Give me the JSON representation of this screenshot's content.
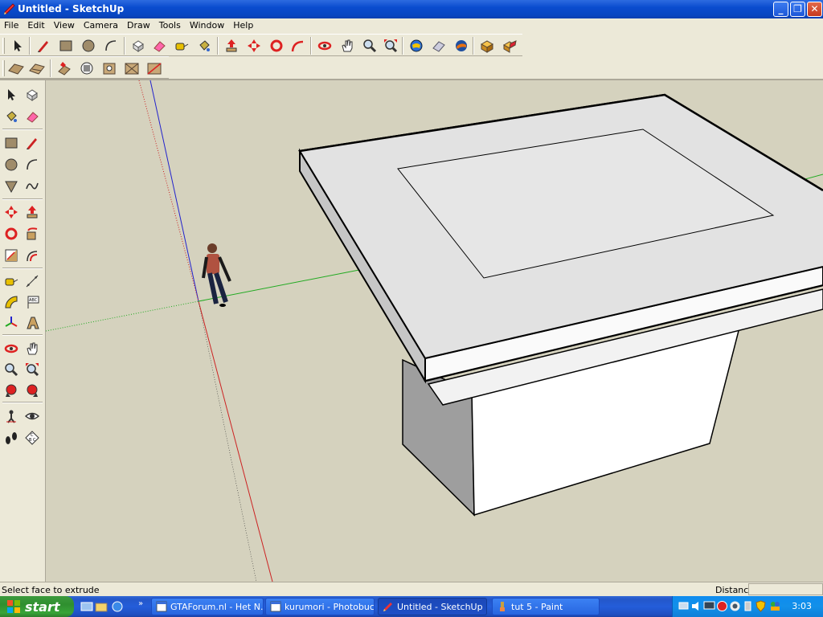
{
  "window": {
    "title": "Untitled - SketchUp",
    "icon": "sketchup-logo-icon",
    "controls": [
      "minimize-icon",
      "maximize-icon",
      "close-icon"
    ]
  },
  "menu": [
    "File",
    "Edit",
    "View",
    "Camera",
    "Draw",
    "Tools",
    "Window",
    "Help"
  ],
  "toolbar_top": [
    "select-arrow-icon",
    "pencil-icon",
    "rectangle-icon",
    "circle-icon",
    "arc-icon",
    "make-component-icon",
    "eraser-icon",
    "tape-measure-icon",
    "paint-bucket-icon",
    "push-pull-icon",
    "move-icon",
    "rotate-icon",
    "follow-me-icon",
    "orbit-icon",
    "pan-hand-icon",
    "zoom-icon",
    "zoom-extents-icon",
    "get-models-icon",
    "share-model-icon",
    "google-earth-icon",
    "component-box-icon",
    "component-open-icon"
  ],
  "toolbar_second": [
    "sandbox-smoove-icon",
    "sandbox-from-contours-icon",
    "drape-icon",
    "add-detail-icon",
    "flip-edge-icon",
    "stamp-icon",
    "sandbox-grid-icon"
  ],
  "palette": [
    "select-icon",
    "make-component-icon",
    "paint-bucket-icon",
    "eraser-icon",
    "rectangle-icon",
    "pencil-icon",
    "circle-icon",
    "arc-icon",
    "polygon-icon",
    "freehand-icon",
    "move-icon",
    "push-pull-icon",
    "rotate-icon",
    "follow-me-icon",
    "scale-icon",
    "offset-icon",
    "tape-measure-icon",
    "dimension-icon",
    "protractor-icon",
    "text-icon",
    "axes-icon",
    "3d-text-icon",
    "orbit-icon",
    "pan-icon",
    "zoom-icon",
    "zoom-window-icon",
    "previous-view-icon",
    "next-view-icon",
    "position-camera-icon",
    "look-around-icon",
    "walk-icon",
    "section-plane-icon"
  ],
  "status": {
    "hint": "Select face to extrude",
    "vcb_label": "Distance",
    "vcb_value": ""
  },
  "taskbar": {
    "start_label": "start",
    "quick_launch": [
      "show-desktop-icon",
      "explorer-icon",
      "browser-icon"
    ],
    "tasks": [
      {
        "label": "GTAForum.nl - Het N...",
        "icon": "browser-page-icon",
        "active": false
      },
      {
        "label": "kurumori - Photobuck...",
        "icon": "browser-page-icon",
        "active": false
      },
      {
        "label": "Untitled - SketchUp",
        "icon": "sketchup-logo-icon",
        "active": true
      },
      {
        "label": "tut 5 - Paint",
        "icon": "paint-icon",
        "active": false
      }
    ],
    "clock": "3:03"
  },
  "colors": {
    "titlebar": "#0a4ccf",
    "viewport_bg": "#d5d2be",
    "model_face": "#ffffff",
    "model_top": "#e6e6e6",
    "model_side": "#b0b0b0",
    "axis_red": "#cc2222",
    "axis_green": "#22aa22",
    "axis_blue": "#2222cc"
  }
}
